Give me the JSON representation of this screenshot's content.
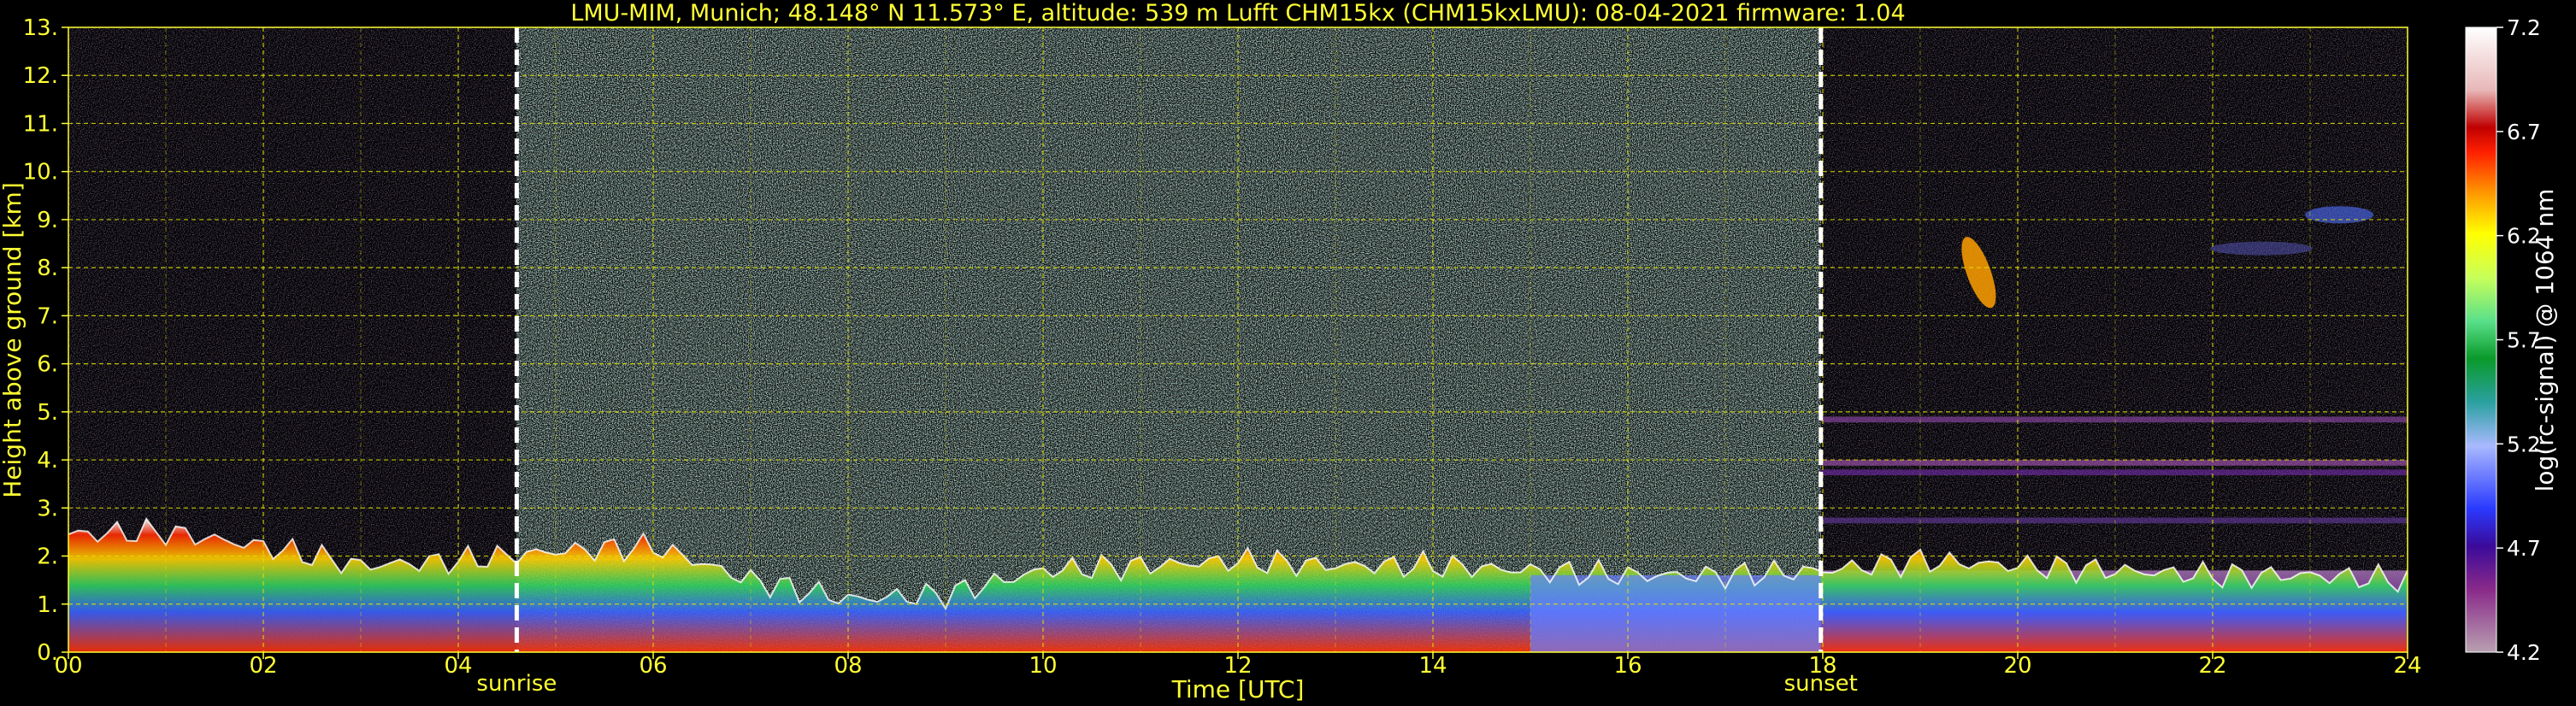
{
  "chart_data": {
    "type": "heatmap",
    "title": "LMU-MIM, Munich; 48.148° N 11.573° E, altitude: 539 m    Lufft CHM15kx (CHM15kxLMU): 08-04-2021    firmware: 1.04",
    "xlabel": "Time [UTC]",
    "ylabel": "Height above ground [km]",
    "xlim": [
      0,
      24
    ],
    "ylim": [
      0,
      13
    ],
    "x_ticks": [
      "00",
      "02",
      "04",
      "06",
      "08",
      "10",
      "12",
      "14",
      "16",
      "18",
      "20",
      "22",
      "24"
    ],
    "y_ticks": [
      "0.",
      "1.",
      "2.",
      "3.",
      "4.",
      "5.",
      "6.",
      "7.",
      "8.",
      "9.",
      "10.",
      "11.",
      "12.",
      "13."
    ],
    "grid": true,
    "markers": [
      {
        "label": "sunrise",
        "x": 4.6
      },
      {
        "label": "sunset",
        "x": 17.98
      }
    ],
    "colorbar": {
      "label": "log(rc-signal) @ 1064 nm",
      "range": [
        4.2,
        7.2
      ],
      "ticks": [
        "4.2",
        "4.7",
        "5.2",
        "5.7",
        "6.2",
        "6.7",
        "7.2"
      ]
    },
    "boundary_layer_top_km": [
      [
        0,
        2.45
      ],
      [
        1,
        2.5
      ],
      [
        2,
        2.2
      ],
      [
        3,
        1.8
      ],
      [
        4,
        1.9
      ],
      [
        5,
        2.1
      ],
      [
        6,
        2.2
      ],
      [
        7,
        1.5
      ],
      [
        8,
        1.1
      ],
      [
        9,
        1.2
      ],
      [
        10,
        1.7
      ],
      [
        11,
        1.8
      ],
      [
        12,
        1.9
      ],
      [
        13,
        1.8
      ],
      [
        14,
        1.8
      ],
      [
        15,
        1.7
      ],
      [
        16,
        1.6
      ],
      [
        17,
        1.6
      ],
      [
        18,
        1.7
      ],
      [
        19,
        1.9
      ],
      [
        20,
        1.8
      ],
      [
        21,
        1.7
      ],
      [
        22,
        1.6
      ],
      [
        23,
        1.6
      ],
      [
        24,
        1.5
      ]
    ],
    "colors": {
      "text": "#ffff33",
      "grid": "#e0e000",
      "background": "#000000"
    }
  }
}
